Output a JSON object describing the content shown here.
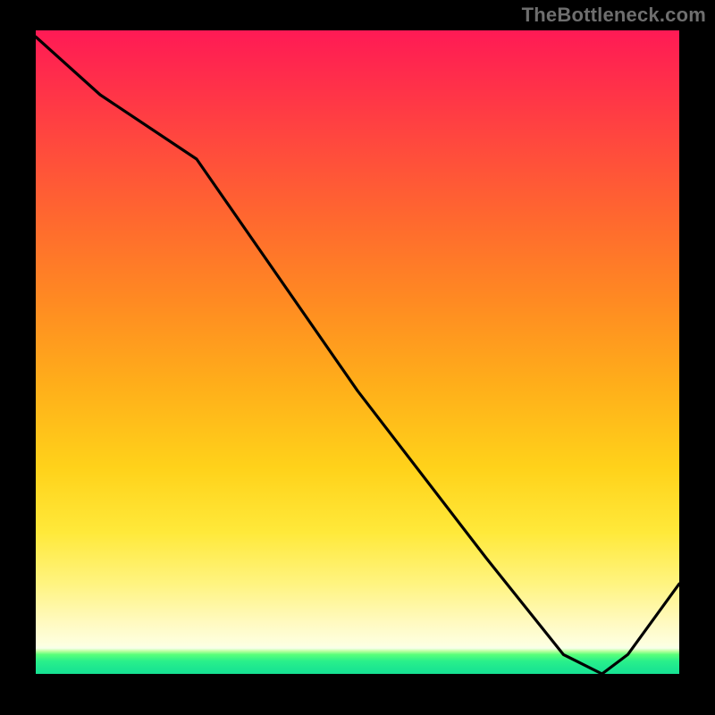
{
  "watermark": "TheBottleneck.com",
  "baseline_label": "         ",
  "chart_data": {
    "type": "line",
    "title": "",
    "xlabel": "",
    "ylabel": "",
    "xlim": [
      0,
      100
    ],
    "ylim": [
      0,
      100
    ],
    "series": [
      {
        "name": "curve",
        "x": [
          0,
          10,
          25,
          50,
          70,
          82,
          88,
          92,
          100
        ],
        "y": [
          99,
          90,
          80,
          44,
          18,
          3,
          0,
          3,
          14
        ]
      }
    ],
    "background_gradient_stops": [
      {
        "pos": 0.0,
        "color": "#ff1a55"
      },
      {
        "pos": 0.3,
        "color": "#ff6a2e"
      },
      {
        "pos": 0.68,
        "color": "#ffd21a"
      },
      {
        "pos": 0.95,
        "color": "#fdffe0"
      },
      {
        "pos": 1.0,
        "color": "#17e293"
      }
    ],
    "minimum_marker": {
      "x": 88,
      "y": 0
    }
  }
}
